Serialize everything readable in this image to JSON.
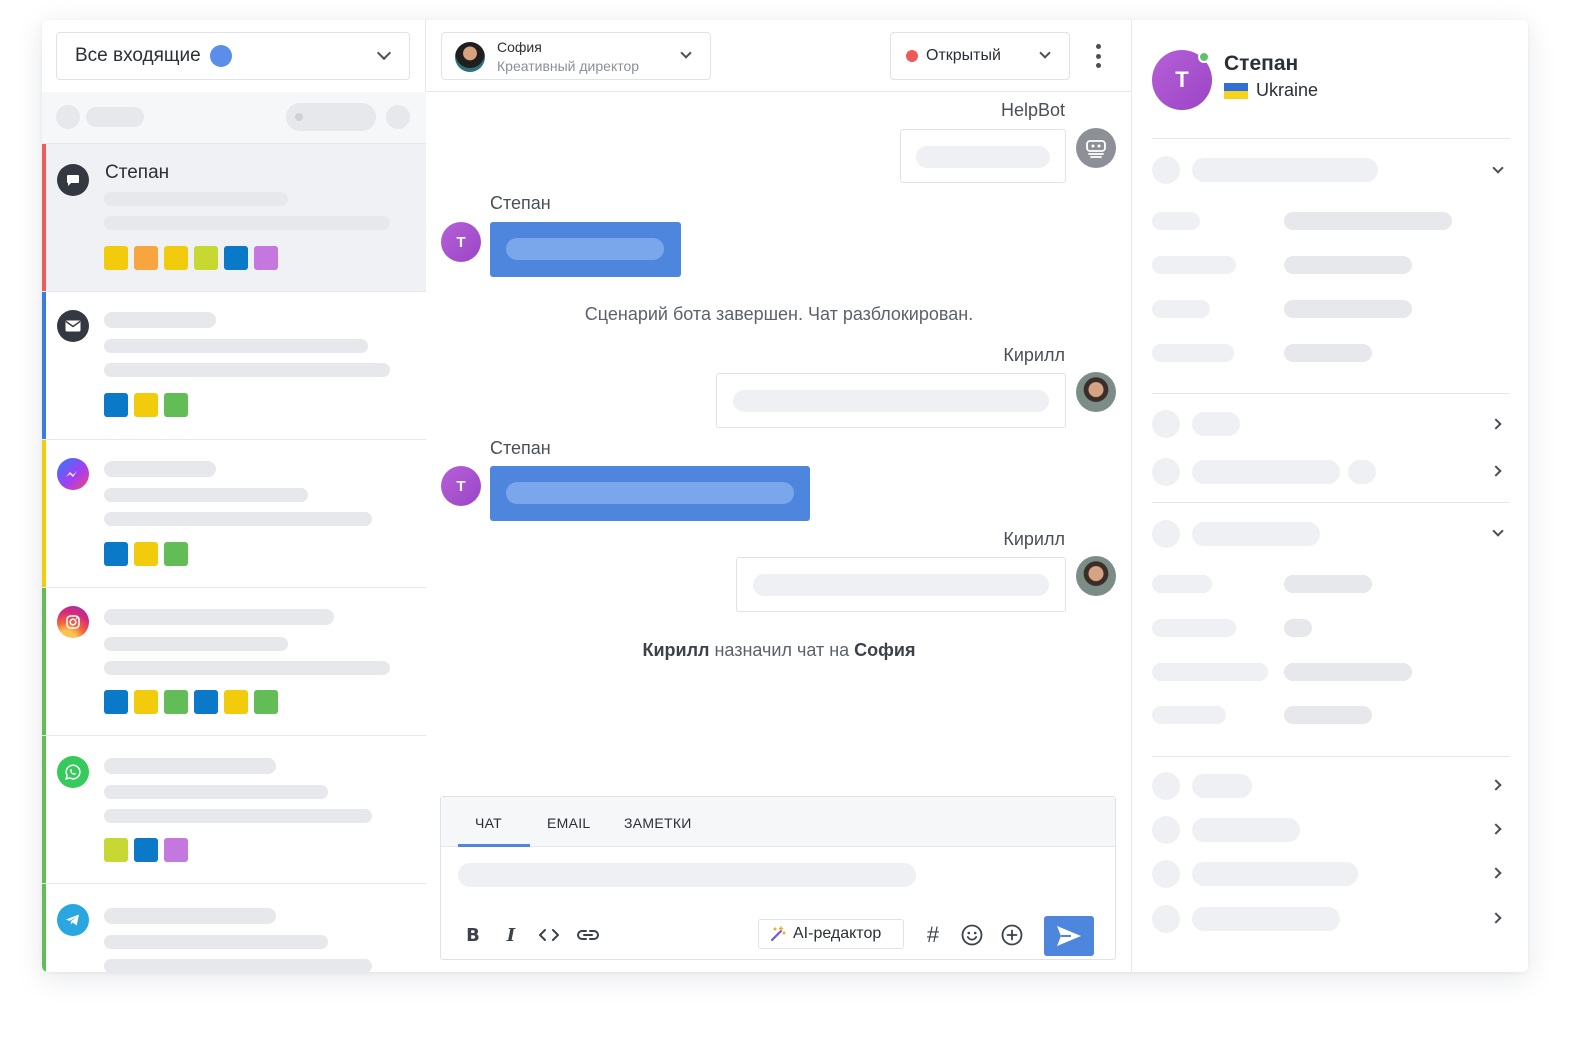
{
  "inbox": {
    "selected": "Все входящие",
    "dot_color": "#5b8dea"
  },
  "conversations": [
    {
      "channel": "chat-icon",
      "name": "Степан",
      "bar_color": "#ee5a5a",
      "active": true,
      "tags": [
        "#f2cc0c",
        "#f8a53f",
        "#f2cc0c",
        "#c8d832",
        "#0a79c7",
        "#c577e0"
      ]
    },
    {
      "channel": "email-icon",
      "name": "",
      "bar_color": "#3d7be0",
      "tags": [
        "#0a79c7",
        "#f2cc0c",
        "#62bd56"
      ]
    },
    {
      "channel": "messenger-icon",
      "name": "",
      "bar_color": "#f2cc0c",
      "tags": [
        "#0a79c7",
        "#f2cc0c",
        "#62bd56"
      ]
    },
    {
      "channel": "instagram-icon",
      "name": "",
      "bar_color": "#62bd56",
      "tags": [
        "#0a79c7",
        "#f2cc0c",
        "#62bd56",
        "#0a79c7",
        "#f2cc0c",
        "#62bd56"
      ]
    },
    {
      "channel": "whatsapp-icon",
      "name": "",
      "bar_color": "#62bd56",
      "tags": [
        "#c8d832",
        "#0a79c7",
        "#c577e0"
      ]
    },
    {
      "channel": "telegram-icon",
      "name": "",
      "bar_color": "#62bd56",
      "tags": []
    }
  ],
  "header": {
    "agent_name": "София",
    "agent_role": "Креативный директор",
    "status_label": "Открытый",
    "status_color": "#ee5a5a"
  },
  "messages": {
    "bot_name": "HelpBot",
    "customer_name": "Степан",
    "customer_initial": "T",
    "agent_name": "Кирилл",
    "system_bot_done": "Сценарий бота завершен. Чат разблокирован.",
    "assign_actor": "Кирилл",
    "assign_text": " назначил чат на ",
    "assign_target": "София"
  },
  "composer": {
    "tab_chat": "ЧАТ",
    "tab_email": "EMAIL",
    "tab_notes": "ЗАМЕТКИ",
    "ai_label": "AI-редактор",
    "accent": "#4f86dd"
  },
  "contact": {
    "initial": "T",
    "name": "Степан",
    "country": "Ukraine"
  }
}
